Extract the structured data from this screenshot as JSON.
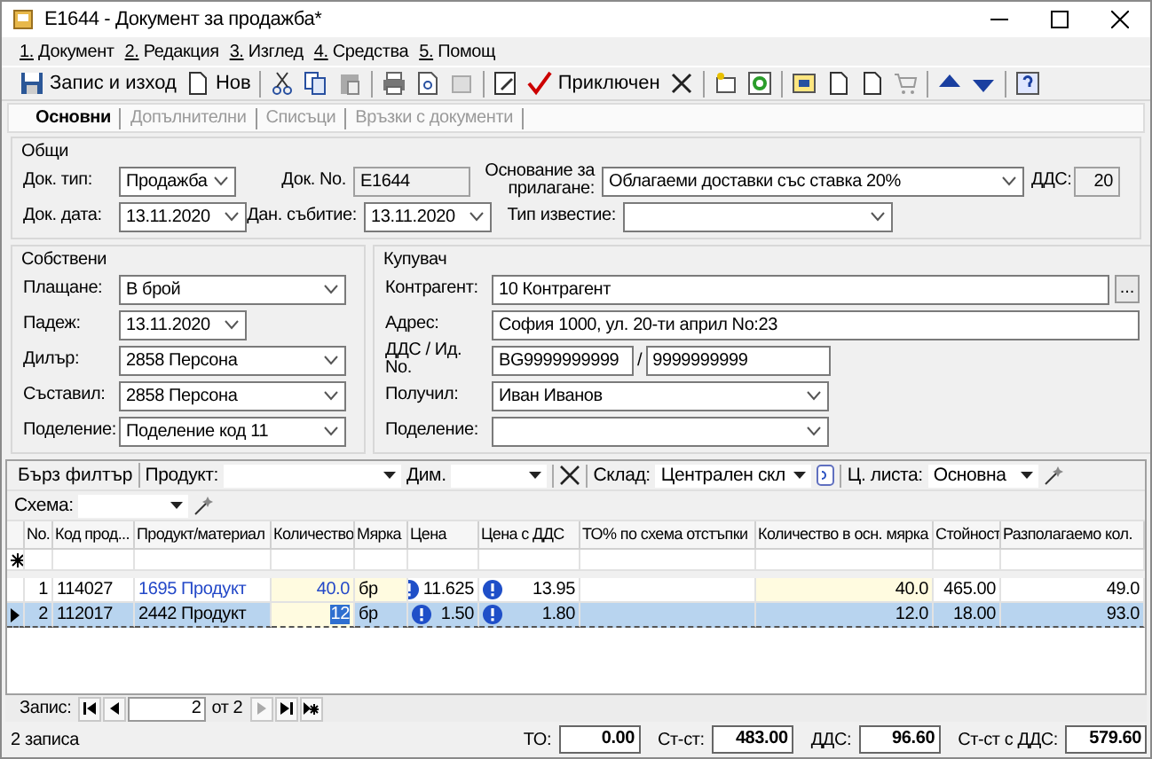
{
  "window": {
    "title": "E1644 - Документ за продажба*"
  },
  "menu": [
    "1. Документ",
    "2. Редакция",
    "3. Изглед",
    "4. Средства",
    "5. Помощ"
  ],
  "toolbar": [
    "Запис и изход",
    "Нов",
    "Приключен"
  ],
  "tabs": [
    {
      "label": "Основни",
      "selected": true
    },
    {
      "label": "Допълнителни",
      "selected": false
    },
    {
      "label": "Списъци",
      "selected": false
    },
    {
      "label": "Връзки с документи",
      "selected": false
    }
  ],
  "general": {
    "title": "Общи",
    "rows": [
      [
        {
          "label": "Док. тип:",
          "kind": "select",
          "value": "Продажба"
        },
        {
          "label": "Док. No.",
          "kind": "readonly",
          "value": "E1644"
        },
        {
          "label": "Основание за прилагане:",
          "kind": "select",
          "value": "Облагаеми доставки със ставка 20%"
        },
        {
          "label": "ДДС:",
          "kind": "readonly",
          "value": "20"
        }
      ],
      [
        {
          "label": "Док. дата:",
          "kind": "select",
          "value": "13.11.2020"
        },
        {
          "label": "Дан. събитие:",
          "kind": "select",
          "value": "13.11.2020"
        },
        {
          "label": "Тип известие:",
          "kind": "select"
        }
      ]
    ]
  },
  "own": {
    "title": "Собствени",
    "fields": [
      {
        "label": "Плащане:",
        "kind": "select",
        "value": "В брой"
      },
      {
        "label": "Падеж:",
        "kind": "date",
        "value": "13.11.2020"
      },
      {
        "label": "Дилър:",
        "kind": "select",
        "value": "2858 Персона"
      },
      {
        "label": "Съставил:",
        "kind": "select",
        "value": "2858 Персона"
      },
      {
        "label": "Поделение:",
        "kind": "select",
        "value": "Поделение код 11"
      }
    ]
  },
  "buyer": {
    "title": "Купувач",
    "fields": [
      {
        "label": "Контрагент:",
        "kind": "text",
        "value": "10 Контрагент",
        "button": "..."
      },
      {
        "label": "Адрес:",
        "kind": "text",
        "value": "София 1000, ул. 20-ти април No:23"
      },
      {
        "label": "ДДС / Ид. No.",
        "kind": "pair",
        "value": "BG9999999999",
        "separator": "/",
        "value2": "9999999999"
      },
      {
        "label": "Получил:",
        "kind": "select",
        "value": "Иван Иванов"
      },
      {
        "label": "Поделение:",
        "kind": "select"
      }
    ]
  },
  "grid_toolbar": {
    "quick_filter": "Бърз филтър",
    "filters": [
      {
        "label": "Продукт:"
      },
      {
        "label": "Дим."
      },
      {
        "label": "Склад:",
        "value": "Централен скл"
      },
      {
        "label": "Ц. листа:",
        "value": "Основна"
      }
    ],
    "schema": {
      "label": "Схема:"
    }
  },
  "table": {
    "columns": [
      "No.",
      "Код прод...",
      "Продукт/материал",
      "Количество",
      "Мярка",
      "Цена",
      "Цена с ДДС",
      "ТО% по схема отстъпки",
      "Количество в осн. мярка",
      "Стойност",
      "Разполагаемо кол."
    ],
    "rows": [
      {
        "no": "1",
        "code": "114027",
        "product": "1695 Продукт",
        "quantity": "40.0",
        "unit": "бр",
        "price": "11.625",
        "price_with_vat": "13.95",
        "base_quantity": "40.0",
        "value": "465.00",
        "available": "49.0",
        "selected": false
      },
      {
        "no": "2",
        "code": "112017",
        "product": "2442 Продукт",
        "quantity": "12",
        "unit": "бр",
        "price": "1.50",
        "price_with_vat": "1.80",
        "base_quantity": "12.0",
        "value": "18.00",
        "available": "93.0",
        "selected": true
      }
    ]
  },
  "navigator": {
    "label": "Запис:",
    "current": "2",
    "total": "от 2"
  },
  "status_bar": {
    "records": "2 записа",
    "totals": [
      {
        "label": "ТО:",
        "value": "0.00"
      },
      {
        "label": "Ст-ст:",
        "value": "483.00"
      },
      {
        "label": "ДДС:",
        "value": "96.60"
      },
      {
        "label": "Ст-ст с ДДС:",
        "value": "579.60"
      }
    ]
  }
}
